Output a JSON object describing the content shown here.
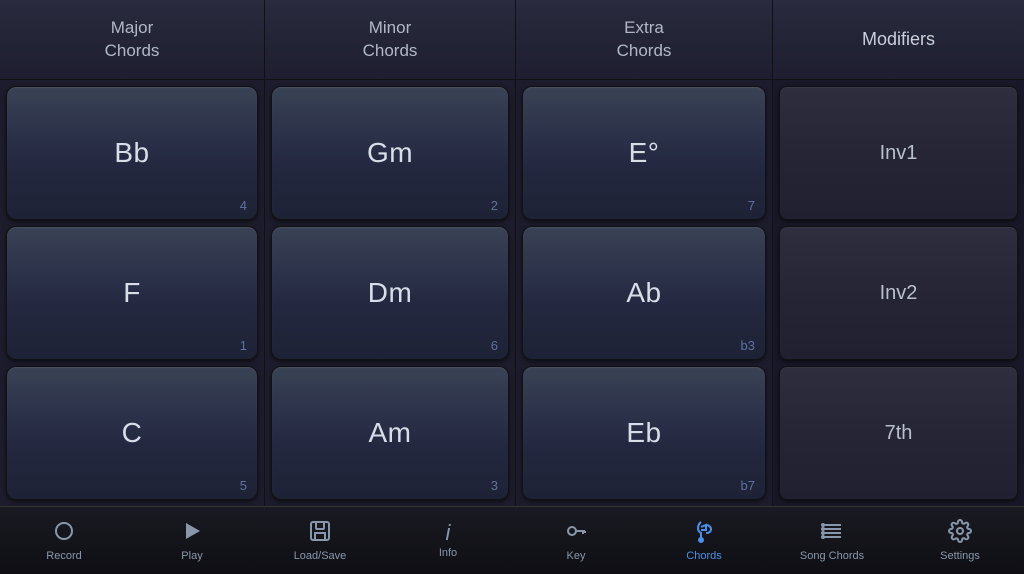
{
  "header": {
    "col1_label": "Major\nChords",
    "col2_label": "Minor\nChords",
    "col3_label": "Extra\nChords",
    "col4_label": "Modifiers"
  },
  "major_chords": [
    {
      "label": "Bb",
      "number": "4"
    },
    {
      "label": "F",
      "number": "1"
    },
    {
      "label": "C",
      "number": "5"
    }
  ],
  "minor_chords": [
    {
      "label": "Gm",
      "number": "2"
    },
    {
      "label": "Dm",
      "number": "6"
    },
    {
      "label": "Am",
      "number": "3"
    }
  ],
  "extra_chords": [
    {
      "label": "E°",
      "number": "7"
    },
    {
      "label": "Ab",
      "number": "b3"
    },
    {
      "label": "Eb",
      "number": "b7"
    }
  ],
  "modifiers": [
    {
      "label": "Inv1"
    },
    {
      "label": "Inv2"
    },
    {
      "label": "7th"
    }
  ],
  "toolbar": {
    "items": [
      {
        "id": "record",
        "label": "Record",
        "icon": "circle"
      },
      {
        "id": "play",
        "label": "Play",
        "icon": "triangle"
      },
      {
        "id": "loadsave",
        "label": "Load/Save",
        "icon": "floppy"
      },
      {
        "id": "info",
        "label": "Info",
        "icon": "info"
      },
      {
        "id": "key",
        "label": "Key",
        "icon": "key"
      },
      {
        "id": "chords",
        "label": "Chords",
        "icon": "music",
        "active": true
      },
      {
        "id": "songchords",
        "label": "Song Chords",
        "icon": "list"
      },
      {
        "id": "settings",
        "label": "Settings",
        "icon": "gear"
      }
    ]
  }
}
